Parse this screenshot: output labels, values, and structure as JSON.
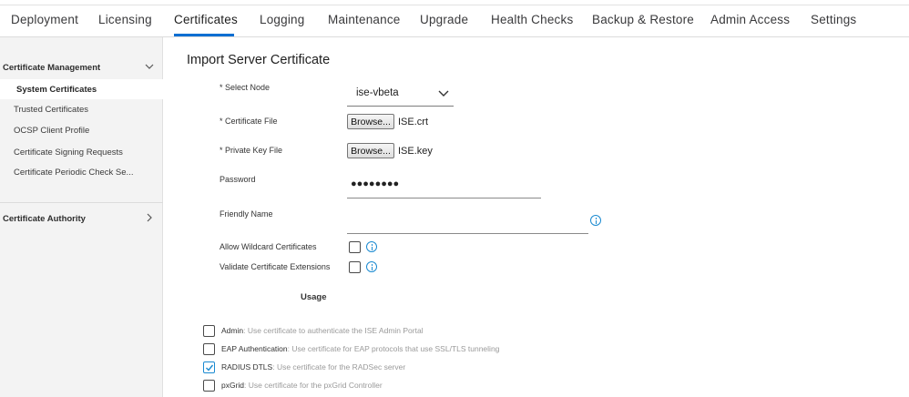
{
  "tabs": [
    {
      "label": "Deployment",
      "active": false
    },
    {
      "label": "Licensing",
      "active": false
    },
    {
      "label": "Certificates",
      "active": true
    },
    {
      "label": "Logging",
      "active": false
    },
    {
      "label": "Maintenance",
      "active": false
    },
    {
      "label": "Upgrade",
      "active": false
    },
    {
      "label": "Health Checks",
      "active": false
    },
    {
      "label": "Backup & Restore",
      "active": false
    },
    {
      "label": "Admin Access",
      "active": false
    },
    {
      "label": "Settings",
      "active": false
    }
  ],
  "sidebar": {
    "sections": [
      {
        "label": "Certificate Management",
        "expanded": true,
        "icon": "chevron-down-icon",
        "items": [
          {
            "label": "System Certificates",
            "selected": true
          },
          {
            "label": "Trusted Certificates",
            "selected": false
          },
          {
            "label": "OCSP Client Profile",
            "selected": false
          },
          {
            "label": "Certificate Signing Requests",
            "selected": false
          },
          {
            "label": "Certificate Periodic Check Se...",
            "selected": false
          }
        ]
      },
      {
        "label": "Certificate Authority",
        "expanded": false,
        "icon": "chevron-right-icon",
        "items": []
      }
    ]
  },
  "form": {
    "title": "Import Server Certificate",
    "select_node_label": "* Select Node",
    "select_node_value": "ise-vbeta",
    "certificate_file_label": "* Certificate File",
    "certificate_browse_label": "Browse...",
    "certificate_file_name": "ISE.crt",
    "private_key_label": "* Private Key File",
    "private_key_browse_label": "Browse...",
    "private_key_file_name": "ISE.key",
    "password_label": "Password",
    "password_value": "●●●●●●●●",
    "friendly_name_label": "Friendly Name",
    "friendly_name_value": "",
    "allow_wildcard_label": "Allow Wildcard Certificates",
    "allow_wildcard_checked": false,
    "validate_extensions_label": "Validate Certificate Extensions",
    "validate_extensions_checked": false,
    "usage_title": "Usage",
    "usage": [
      {
        "name": "Admin",
        "desc": ": Use certificate to authenticate the ISE Admin Portal",
        "checked": false
      },
      {
        "name": "EAP Authentication",
        "desc": ": Use certificate for EAP protocols that use SSL/TLS tunneling",
        "checked": false
      },
      {
        "name": "RADIUS DTLS",
        "desc": ": Use certificate for the RADSec server",
        "checked": true
      },
      {
        "name": "pxGrid",
        "desc": ": Use certificate for the pxGrid Controller",
        "checked": false
      }
    ]
  },
  "colors": {
    "accent": "#0d6ed2",
    "info": "#1a8ad1",
    "sidebar_bg": "#f3f3f3"
  }
}
